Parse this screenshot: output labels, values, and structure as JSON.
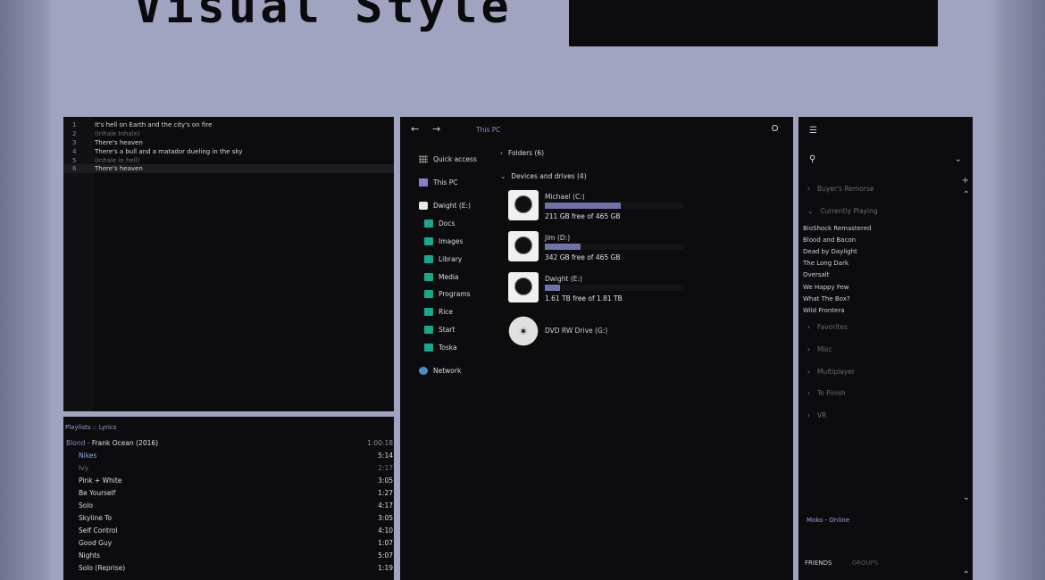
{
  "banner": {
    "title": "Visual Style"
  },
  "editor": {
    "lines": [
      {
        "num": "1",
        "text": "It's hell on Earth and the city's on fire"
      },
      {
        "num": "2",
        "text": "(Inhale Inhale)"
      },
      {
        "num": "3",
        "text": "There's heaven"
      },
      {
        "num": "4",
        "text": "There's a bull and a matador dueling in the sky"
      },
      {
        "num": "5",
        "text": "(Inhale in hell)"
      },
      {
        "num": "6",
        "text": "There's heaven"
      }
    ]
  },
  "playlist": {
    "header": "Playlists :: Lyrics",
    "album_title": "Blond",
    "album_sep": " - ",
    "album_artist": "Frank Ocean (2016)",
    "album_duration": "1:00:18",
    "tracks": [
      {
        "name": "Nikes",
        "duration": "5:14"
      },
      {
        "name": "Ivy",
        "duration": "2:17"
      },
      {
        "name": "Pink + White",
        "duration": "3:05"
      },
      {
        "name": "Be Yourself",
        "duration": "1:27"
      },
      {
        "name": "Solo",
        "duration": "4:17"
      },
      {
        "name": "Skyline To",
        "duration": "3:05"
      },
      {
        "name": "Self Control",
        "duration": "4:10"
      },
      {
        "name": "Good Guy",
        "duration": "1:07"
      },
      {
        "name": "Nights",
        "duration": "5:07"
      },
      {
        "name": "Solo (Reprise)",
        "duration": "1:19"
      }
    ]
  },
  "explorer": {
    "breadcrumb": "This PC",
    "sidebar": {
      "quick_access": "Quick access",
      "this_pc": "This PC",
      "drive": "Dwight (E:)",
      "folders": [
        "Docs",
        "Images",
        "Library",
        "Media",
        "Programs",
        "Rice",
        "Start",
        "Toska"
      ],
      "network": "Network"
    },
    "folders_section": "Folders (6)",
    "devices_section": "Devices and drives (4)",
    "drives": [
      {
        "name": "Michael (C:)",
        "free": "211 GB free of 465 GB",
        "used_fraction": 0.55
      },
      {
        "name": "Jim (D:)",
        "free": "342 GB free of 465 GB",
        "used_fraction": 0.26
      },
      {
        "name": "Dwight (E:)",
        "free": "1.61 TB free of 1.81 TB",
        "used_fraction": 0.11
      }
    ],
    "dvd": "DVD RW Drive (G:)"
  },
  "friends": {
    "categories_top": [
      "Buyer's Remorse",
      "Currently Playing"
    ],
    "games": [
      "BioShock Remastered",
      "Blood and Bacon",
      "Dead by Daylight",
      "The Long Dark",
      "Oversalt",
      "We Happy Few",
      "What The Box?",
      "Wild Frontera"
    ],
    "categories_bottom": [
      "Favorites",
      "Misc",
      "Multiplayer",
      "To Finish",
      "VR"
    ],
    "user": "Moko",
    "status_sep": "-",
    "status": "Online",
    "tab_friends": "FRIENDS",
    "tab_groups": "GROUPS"
  }
}
